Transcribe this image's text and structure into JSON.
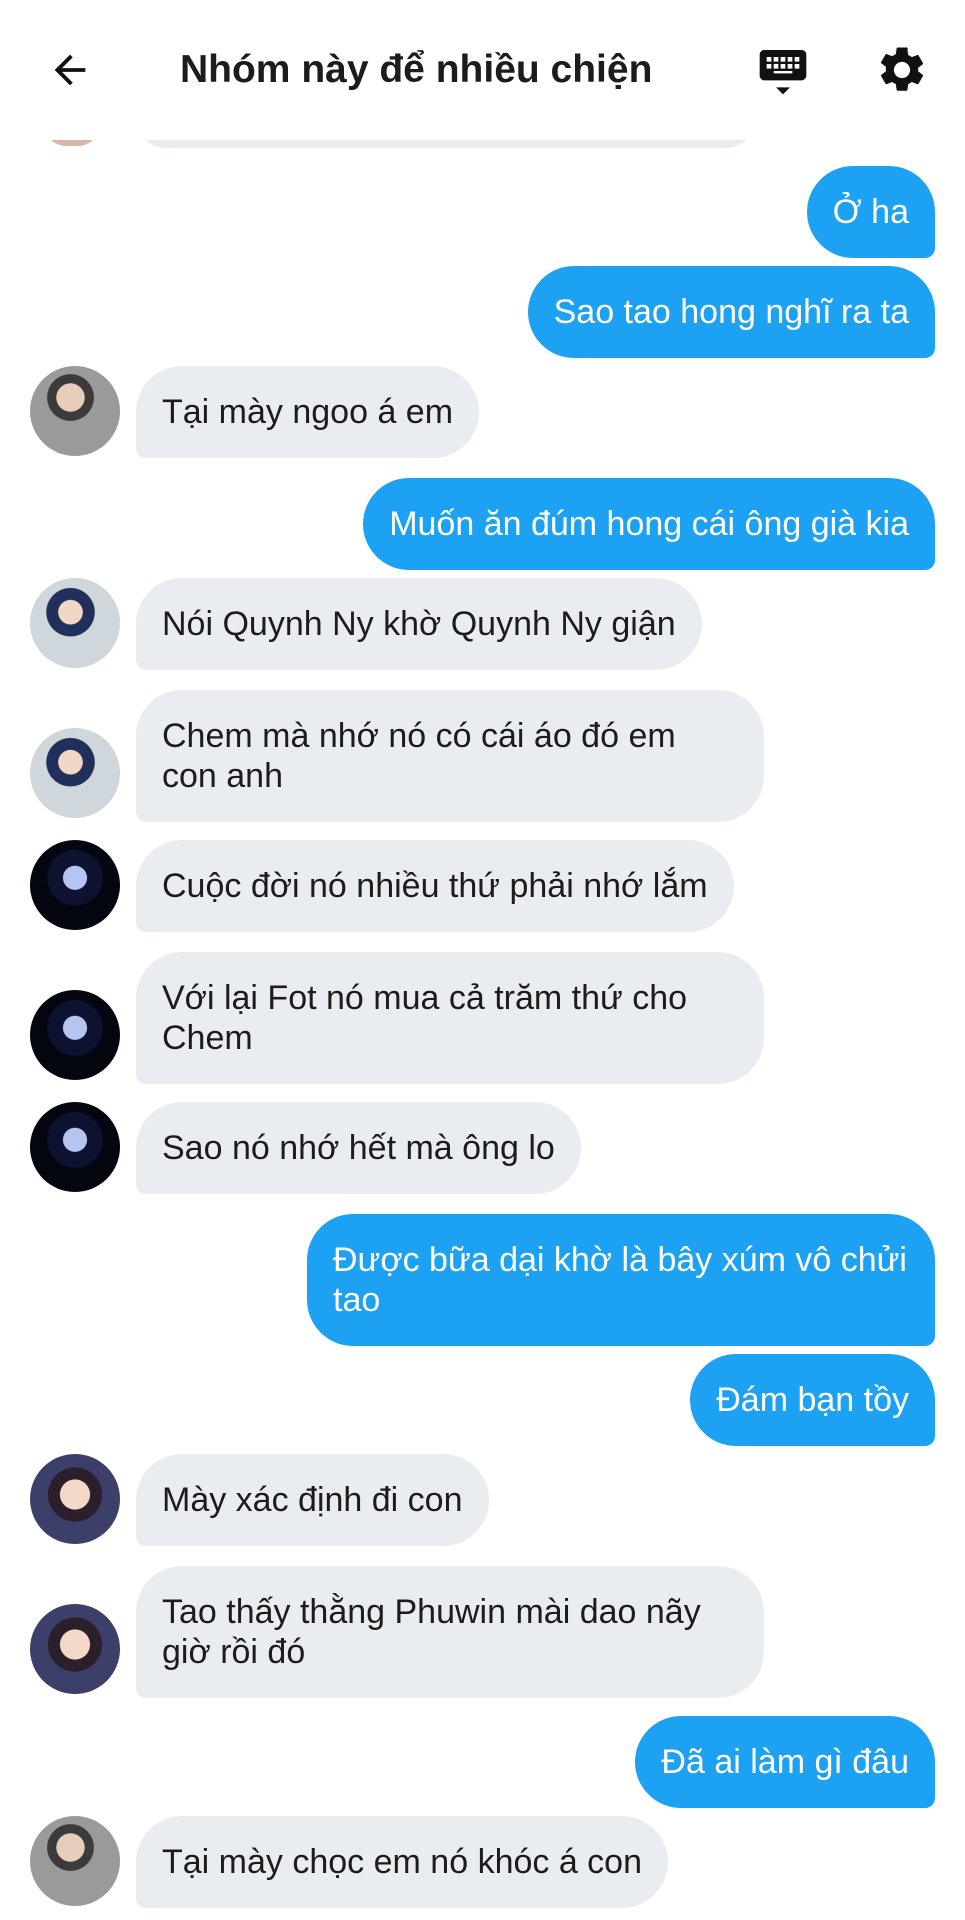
{
  "header": {
    "title": "Nhóm này để nhiều chiện",
    "back_icon": "arrow-left-icon",
    "keyboard_icon": "keyboard-icon",
    "settings_icon": "gear-icon"
  },
  "colors": {
    "outgoing_bubble": "#1da1f2",
    "incoming_bubble": "#e9edf1",
    "text_dark": "#1c1c1c"
  },
  "messages": [
    {
      "dir": "out",
      "text": "Ở ha"
    },
    {
      "dir": "out",
      "text": "Sao tao hong nghĩ ra ta"
    },
    {
      "dir": "in",
      "text": "Tại mày ngoo á em"
    },
    {
      "dir": "out",
      "text": "Muốn ăn đúm hong cái ông già kia"
    },
    {
      "dir": "in",
      "text": "Nói Quynh Ny khờ Quynh Ny giận"
    },
    {
      "dir": "in",
      "text": "Chem mà nhớ nó có cái áo đó em\ncon anh"
    },
    {
      "dir": "in",
      "text": "Cuộc đời nó nhiều thứ phải nhớ lắm"
    },
    {
      "dir": "in",
      "text": "Với lại Fot nó mua cả trăm thứ cho\nChem"
    },
    {
      "dir": "in",
      "text": "Sao nó nhớ hết mà ông lo"
    },
    {
      "dir": "out",
      "text": "Được bữa dại khờ là bây xúm vô chửi\ntao"
    },
    {
      "dir": "out",
      "text": "Đám bạn tồy"
    },
    {
      "dir": "in",
      "text": "Mày xác định đi con"
    },
    {
      "dir": "in",
      "text": "Tao thấy thằng Phuwin mài dao nãy\ngiờ rồi đó"
    },
    {
      "dir": "out",
      "text": "Đã ai làm gì đâu"
    },
    {
      "dir": "in",
      "text": "Tại mày chọc em nó khóc á con"
    }
  ]
}
